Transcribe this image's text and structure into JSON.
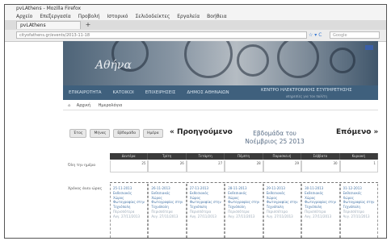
{
  "window": {
    "title": "pvLAthens - Mozilla Firefox"
  },
  "menu": [
    "Αρχείο",
    "Επεξεργασία",
    "Προβολή",
    "Ιστορικό",
    "Σελιδοδείκτες",
    "Εργαλεία",
    "Βοήθεια"
  ],
  "tab": {
    "label": "pvLAthens",
    "new_tab": "+"
  },
  "urlbar": {
    "url": "cityofathens.gr/events/2013-11-18",
    "nav": "☆ ▾ C",
    "search_placeholder": "Google"
  },
  "banner": {
    "text": "Αθήνα"
  },
  "nav": {
    "items": [
      "ΕΠΙΚΑΙΡΟΤΗΤΑ",
      "ΚΑΤΟΙΚΟΙ",
      "ΕΠΙΧΕΙΡΗΣΕΙΣ",
      "ΔΗΜΟΣ ΑΘΗΝΑΙΩΝ"
    ],
    "wide_item": "ΚΕΝΤΡΟ ΗΛΕΚΤΡΟΝΙΚΗΣ ΕΞΥΠΗΡΕΤΗΣΗΣ",
    "wide_sub": "υπηρεσίες για τον πολίτη"
  },
  "breadcrumb": {
    "home": "⌂",
    "items": [
      "Αρχική",
      "Ημερολόγιο"
    ]
  },
  "calendar": {
    "views": [
      "Έτος",
      "Μήνας",
      "Εβδομάδα",
      "Ημέρα"
    ],
    "prev": "« Προηγούμενο",
    "title_line1": "Εβδομάδα του",
    "title_line2": "Νοέμβριος 25 2013",
    "next": "Επόμενο »",
    "days": [
      "Δευτέρα",
      "Τρίτη",
      "Τετάρτη",
      "Πέμπτη",
      "Παρασκευή",
      "Σάββατο",
      "Κυριακή"
    ],
    "day_numbers": [
      "25",
      "26",
      "27",
      "28",
      "29",
      "30",
      "1"
    ],
    "allday_label": "Όλη την ημέρα",
    "time_label": "Χρόνος άνευ ώρας",
    "events": [
      {
        "date": "25-11-2013",
        "l1": "Εκθεσιακός",
        "l2": "Χώρος",
        "l3": "Φωτογραφίας στην",
        "l4": "Τεχνόπολη",
        "muted1": "Περισσότερα",
        "muted2": "Αυγ. 27/11/2013"
      },
      {
        "date": "26-11-2013",
        "l1": "Εκθεσιακός",
        "l2": "Χώρος",
        "l3": "Φωτογραφίας στην",
        "l4": "Τεχνόπολη",
        "muted1": "Περισσότερα",
        "muted2": "Αυγ. 27/11/2013"
      },
      {
        "date": "27-11-2013",
        "l1": "Εκθεσιακός",
        "l2": "Χώρος",
        "l3": "Φωτογραφίας στην",
        "l4": "Τεχνόπολη",
        "muted1": "Περισσότερα",
        "muted2": "Αυγ. 27/11/2013"
      },
      {
        "date": "28-11-2013",
        "l1": "Εκθεσιακός",
        "l2": "Χώρος",
        "l3": "Φωτογραφίας στην",
        "l4": "Τεχνόπολη",
        "muted1": "Περισσότερα",
        "muted2": "Αυγ. 27/11/2013"
      },
      {
        "date": "29-11-2013",
        "l1": "Εκθεσιακός",
        "l2": "Χώρος",
        "l3": "Φωτογραφίας στην",
        "l4": "Τεχνόπολη",
        "muted1": "Περισσότερα",
        "muted2": "Αυγ. 27/11/2013"
      },
      {
        "date": "30-11-2013",
        "l1": "Εκθεσιακός",
        "l2": "Χώρος",
        "l3": "Φωτογραφίας στην",
        "l4": "Τεχνόπολη",
        "muted1": "Περισσότερα",
        "muted2": "Αυγ. 27/11/2013"
      },
      {
        "date": "01-12-2013",
        "l1": "Εκθεσιακός",
        "l2": "Χώρος",
        "l3": "Φωτογραφίας στην",
        "l4": "Τεχνόπολη",
        "muted1": "Περισσότερα",
        "muted2": "Αυγ. 27/11/2013"
      }
    ]
  }
}
